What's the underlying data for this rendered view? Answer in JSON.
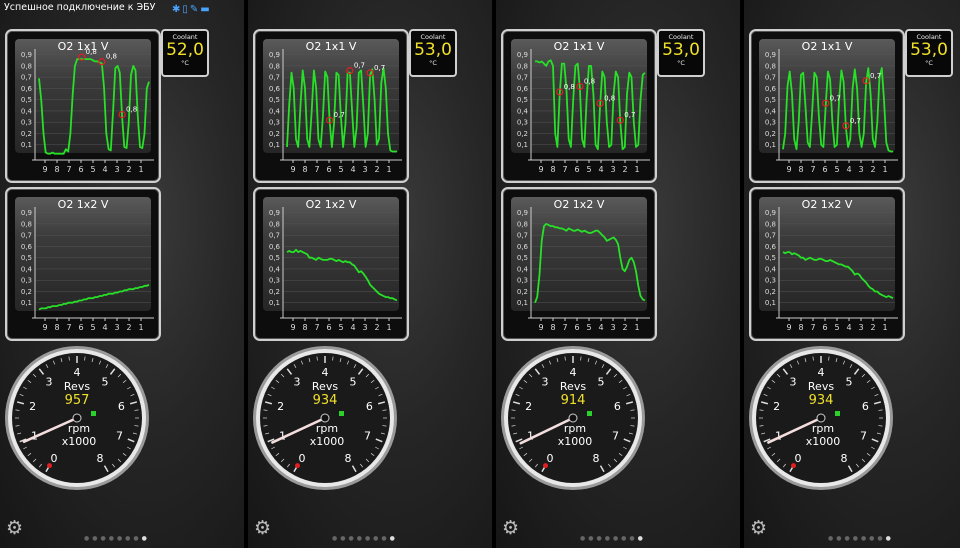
{
  "status_bar": {
    "text": "Успешное подключение к ЭБУ",
    "icons": [
      "bluetooth-icon",
      "phone-icon",
      "pen-icon",
      "car-icon"
    ]
  },
  "colors": {
    "line": "#27e027",
    "gauge_value": "#f0e02a",
    "coolant_value": "#f0e02a",
    "bluetooth_icon": "#4aa3ff"
  },
  "chart_axis": {
    "y_ticks": [
      "0,9",
      "0,8",
      "0,7",
      "0,6",
      "0,5",
      "0,4",
      "0,3",
      "0,2",
      "0,1"
    ],
    "x_ticks": [
      "9",
      "8",
      "7",
      "6",
      "5",
      "4",
      "3",
      "2",
      "1"
    ]
  },
  "gauge_ticks": [
    "0",
    "1",
    "2",
    "3",
    "4",
    "5",
    "6",
    "7",
    "8"
  ],
  "settings_icon": "gear-icon",
  "panels": [
    {
      "o2_1": {
        "title": "O2 1x1  V",
        "markers": [
          "0,8",
          "0,8",
          "0,8"
        ],
        "values": [
          0.69,
          0.5,
          0.2,
          0.03,
          0.02,
          0.02,
          0.03,
          0.02,
          0.02,
          0.02,
          0.02,
          0.02,
          0.06,
          0.04,
          0.2,
          0.55,
          0.8,
          0.86,
          0.86,
          0.86,
          0.86,
          0.86,
          0.86,
          0.86,
          0.85,
          0.84,
          0.84,
          0.83,
          0.82,
          0.6,
          0.2,
          0.06,
          0.05,
          0.4,
          0.78,
          0.8,
          0.74,
          0.35,
          0.08,
          0.07,
          0.3,
          0.72,
          0.8,
          0.76,
          0.35,
          0.08,
          0.07,
          0.2,
          0.6,
          0.66
        ]
      },
      "o2_2": {
        "title": "O2 1x2  V",
        "values": [
          0.04,
          0.05,
          0.05,
          0.05,
          0.06,
          0.06,
          0.07,
          0.07,
          0.07,
          0.08,
          0.08,
          0.09,
          0.09,
          0.1,
          0.1,
          0.1,
          0.11,
          0.11,
          0.12,
          0.12,
          0.13,
          0.13,
          0.14,
          0.14,
          0.14,
          0.15,
          0.15,
          0.16,
          0.16,
          0.17,
          0.17,
          0.18,
          0.18,
          0.18,
          0.19,
          0.19,
          0.2,
          0.2,
          0.21,
          0.21,
          0.22,
          0.22,
          0.22,
          0.23,
          0.23,
          0.24,
          0.24,
          0.25,
          0.25,
          0.26
        ]
      },
      "coolant": {
        "label": "Coolant",
        "value": "52,0",
        "unit": "°C"
      },
      "gauge": {
        "label": "Revs",
        "value": "957",
        "unit": "rpm\nx1000",
        "rpm": 957
      }
    },
    {
      "o2_1": {
        "title": "O2 1x1  V",
        "markers": [
          "0,7",
          "0,7",
          "0,7"
        ],
        "values": [
          0.08,
          0.45,
          0.74,
          0.6,
          0.15,
          0.08,
          0.45,
          0.76,
          0.6,
          0.15,
          0.08,
          0.4,
          0.76,
          0.6,
          0.15,
          0.08,
          0.35,
          0.75,
          0.7,
          0.3,
          0.08,
          0.3,
          0.74,
          0.72,
          0.35,
          0.08,
          0.28,
          0.74,
          0.74,
          0.4,
          0.08,
          0.25,
          0.74,
          0.76,
          0.45,
          0.08,
          0.2,
          0.72,
          0.77,
          0.5,
          0.1,
          0.15,
          0.65,
          0.78,
          0.6,
          0.2,
          0.05,
          0.04,
          0.04,
          0.04
        ]
      },
      "o2_2": {
        "title": "O2 1x2  V",
        "values": [
          0.55,
          0.56,
          0.55,
          0.55,
          0.57,
          0.55,
          0.56,
          0.55,
          0.54,
          0.53,
          0.5,
          0.5,
          0.49,
          0.48,
          0.5,
          0.49,
          0.48,
          0.48,
          0.48,
          0.49,
          0.49,
          0.48,
          0.47,
          0.48,
          0.47,
          0.46,
          0.47,
          0.46,
          0.46,
          0.44,
          0.43,
          0.4,
          0.37,
          0.38,
          0.36,
          0.33,
          0.3,
          0.26,
          0.24,
          0.22,
          0.2,
          0.18,
          0.17,
          0.16,
          0.15,
          0.15,
          0.14,
          0.14,
          0.13,
          0.12
        ]
      },
      "coolant": {
        "label": "Coolant",
        "value": "53,0",
        "unit": "°C"
      },
      "gauge": {
        "label": "Revs",
        "value": "934",
        "unit": "rpm\nx1000",
        "rpm": 934
      }
    },
    {
      "o2_1": {
        "title": "O2 1x1  V",
        "markers": [
          "0,8",
          "0,8",
          "0,8",
          "0,7"
        ],
        "values": [
          0.84,
          0.84,
          0.83,
          0.84,
          0.82,
          0.8,
          0.84,
          0.85,
          0.8,
          0.2,
          0.08,
          0.55,
          0.82,
          0.82,
          0.6,
          0.15,
          0.08,
          0.5,
          0.8,
          0.82,
          0.6,
          0.15,
          0.08,
          0.5,
          0.8,
          0.8,
          0.55,
          0.1,
          0.06,
          0.45,
          0.75,
          0.7,
          0.3,
          0.08,
          0.1,
          0.55,
          0.75,
          0.7,
          0.3,
          0.06,
          0.08,
          0.55,
          0.74,
          0.7,
          0.3,
          0.08,
          0.1,
          0.5,
          0.72,
          0.74
        ]
      },
      "o2_2": {
        "title": "O2 1x2  V",
        "values": [
          0.1,
          0.15,
          0.35,
          0.65,
          0.78,
          0.8,
          0.79,
          0.78,
          0.78,
          0.77,
          0.77,
          0.76,
          0.76,
          0.75,
          0.74,
          0.76,
          0.75,
          0.74,
          0.74,
          0.75,
          0.74,
          0.73,
          0.74,
          0.73,
          0.72,
          0.72,
          0.73,
          0.74,
          0.74,
          0.72,
          0.7,
          0.68,
          0.65,
          0.66,
          0.67,
          0.68,
          0.66,
          0.62,
          0.5,
          0.4,
          0.38,
          0.42,
          0.48,
          0.5,
          0.46,
          0.38,
          0.25,
          0.16,
          0.13,
          0.12
        ]
      },
      "coolant": {
        "label": "Coolant",
        "value": "53,0",
        "unit": "°C"
      },
      "gauge": {
        "label": "Revs",
        "value": "914",
        "unit": "rpm\nx1000",
        "rpm": 914
      }
    },
    {
      "o2_1": {
        "title": "O2 1x1  V",
        "markers": [
          "0,7",
          "0,7",
          "0,7"
        ],
        "values": [
          0.06,
          0.2,
          0.62,
          0.75,
          0.55,
          0.15,
          0.06,
          0.3,
          0.72,
          0.74,
          0.45,
          0.12,
          0.08,
          0.4,
          0.74,
          0.7,
          0.35,
          0.1,
          0.08,
          0.45,
          0.75,
          0.68,
          0.3,
          0.08,
          0.1,
          0.5,
          0.76,
          0.66,
          0.25,
          0.08,
          0.15,
          0.6,
          0.77,
          0.6,
          0.2,
          0.08,
          0.2,
          0.65,
          0.78,
          0.55,
          0.15,
          0.08,
          0.3,
          0.7,
          0.78,
          0.5,
          0.12,
          0.05,
          0.04,
          0.04
        ]
      },
      "o2_2": {
        "title": "O2 1x2  V",
        "values": [
          0.55,
          0.54,
          0.55,
          0.55,
          0.53,
          0.54,
          0.53,
          0.52,
          0.5,
          0.5,
          0.48,
          0.49,
          0.5,
          0.49,
          0.48,
          0.48,
          0.49,
          0.49,
          0.48,
          0.47,
          0.47,
          0.48,
          0.47,
          0.46,
          0.45,
          0.44,
          0.44,
          0.43,
          0.42,
          0.42,
          0.4,
          0.38,
          0.35,
          0.36,
          0.35,
          0.32,
          0.3,
          0.28,
          0.25,
          0.23,
          0.22,
          0.2,
          0.2,
          0.18,
          0.17,
          0.16,
          0.15,
          0.16,
          0.15,
          0.14
        ]
      },
      "coolant": {
        "label": "Coolant",
        "value": "53,0",
        "unit": "°C"
      },
      "gauge": {
        "label": "Revs",
        "value": "934",
        "unit": "rpm\nx1000",
        "rpm": 934
      }
    }
  ]
}
